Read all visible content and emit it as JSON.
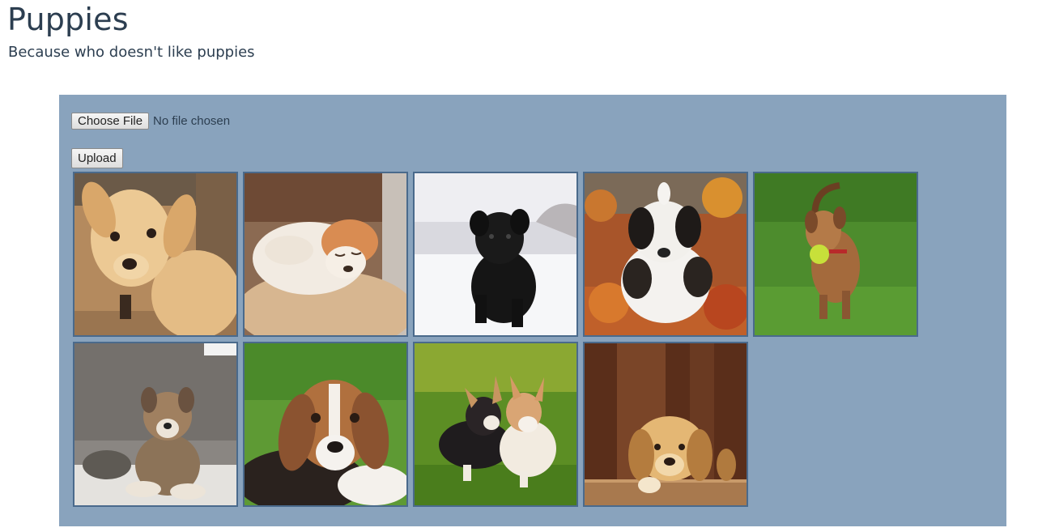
{
  "header": {
    "title": "Puppies",
    "subtitle": "Because who doesn't like puppies"
  },
  "upload_form": {
    "choose_file_label": "Choose File",
    "file_status": "No file chosen",
    "upload_label": "Upload"
  },
  "gallery": {
    "images": [
      {
        "subject": "golden-puppy-on-wood-floor"
      },
      {
        "subject": "sleeping-puppy-on-blanket"
      },
      {
        "subject": "black-puppy-in-snow"
      },
      {
        "subject": "saint-bernard-puppy-in-autumn-leaves"
      },
      {
        "subject": "brown-puppy-with-tennis-ball-on-grass"
      },
      {
        "subject": "fluffy-puppy-on-rocks"
      },
      {
        "subject": "beagle-puppy-on-grass"
      },
      {
        "subject": "two-corgi-puppies-on-grass"
      },
      {
        "subject": "golden-puppy-resting-on-basket"
      }
    ]
  },
  "colors": {
    "panel_background": "#89a3bd",
    "thumb_border": "#4a6a8c",
    "text": "#2c3e50"
  }
}
